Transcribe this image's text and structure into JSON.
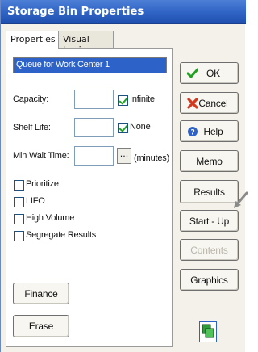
{
  "window": {
    "title": "Storage Bin Properties"
  },
  "tabs": [
    {
      "label": "Properties",
      "active": true
    },
    {
      "label": "Visual Logic",
      "active": false
    }
  ],
  "form": {
    "name_value": "Queue for Work Center 1",
    "capacity_label": "Capacity:",
    "capacity_value": "",
    "infinite_label": "Infinite",
    "infinite_checked": true,
    "shelf_life_label": "Shelf Life:",
    "shelf_life_value": "",
    "none_label": "None",
    "none_checked": true,
    "min_wait_label": "Min Wait Time:",
    "min_wait_value": "",
    "browse_label": "...",
    "minutes_label": "(minutes)",
    "prioritize_label": "Prioritize",
    "lifo_label": "LIFO",
    "high_volume_label": "High Volume",
    "segregate_label": "Segregate Results"
  },
  "left_buttons": {
    "finance": "Finance",
    "erase": "Erase"
  },
  "right_buttons": {
    "ok": "OK",
    "cancel": "Cancel",
    "help": "Help",
    "memo": "Memo",
    "results": "Results",
    "startup": "Start - Up",
    "contents": "Contents",
    "graphics": "Graphics"
  },
  "icons": {
    "ok": "check-icon",
    "cancel": "x-icon",
    "help": "question-icon",
    "graphic": "stacked-boxes-icon",
    "annotation": "pointer-arrow-icon"
  },
  "colors": {
    "titlebar": "#2f63c4",
    "selection": "#2d62c8",
    "check_green": "#21a121",
    "cancel_red": "#d23a1f",
    "graphic_green": "#2f9a3a"
  }
}
